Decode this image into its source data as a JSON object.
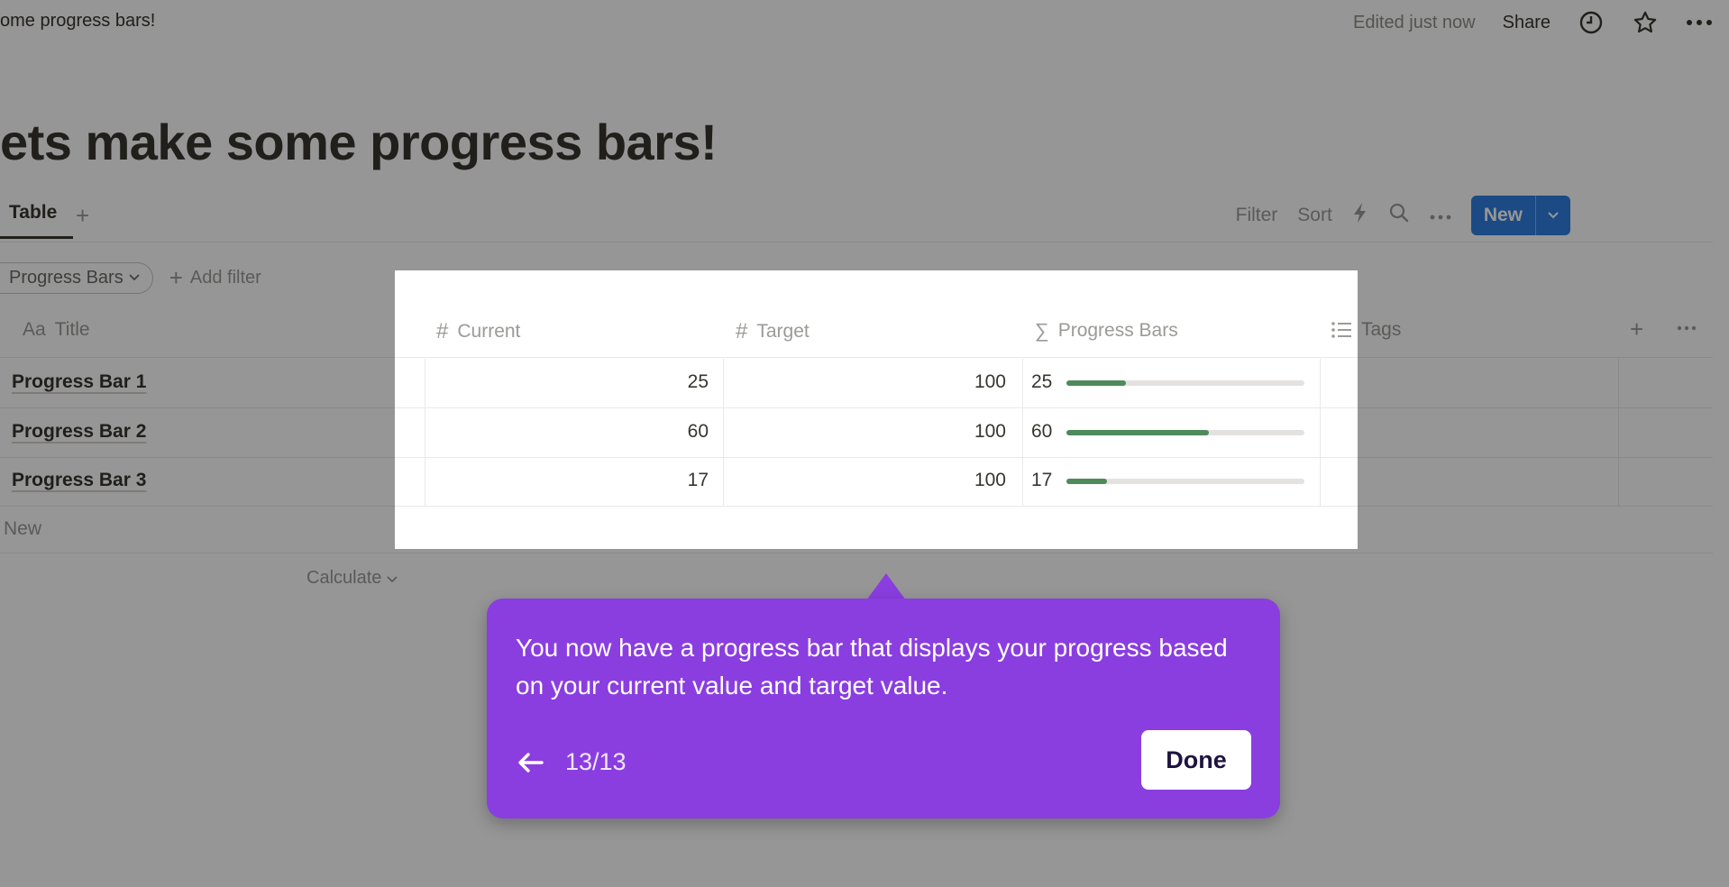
{
  "topbar": {
    "breadcrumb": "ome progress bars!",
    "edited": "Edited just now",
    "share": "Share"
  },
  "page": {
    "title": "ets make some progress bars!"
  },
  "view": {
    "tab_label": "Table",
    "toolbar": {
      "filter": "Filter",
      "sort": "Sort",
      "new": "New"
    }
  },
  "filters": {
    "chip": "Progress Bars",
    "add_filter": "Add filter"
  },
  "table": {
    "columns": {
      "title": "Title",
      "title_icon": "Aa",
      "current": "Current",
      "target": "Target",
      "progress": "Progress Bars",
      "tags": "Tags"
    },
    "rows": [
      {
        "title": "Progress Bar 1",
        "current": "25",
        "target": "100",
        "progress_label": "25",
        "progress": 0.25
      },
      {
        "title": "Progress Bar 2",
        "current": "60",
        "target": "100",
        "progress_label": "60",
        "progress": 0.6
      },
      {
        "title": "Progress Bar 3",
        "current": "17",
        "target": "100",
        "progress_label": "17",
        "progress": 0.17
      }
    ],
    "new_row": "New",
    "calculate": "Calculate"
  },
  "tooltip": {
    "text": "You now have a progress bar that displays your progress based on your current value and target value.",
    "step": "13/13",
    "done": "Done"
  },
  "colors": {
    "accent_new": "#2e7fe0",
    "tooltip": "#8a3ee0",
    "progress_fill": "#4e8a5a"
  }
}
